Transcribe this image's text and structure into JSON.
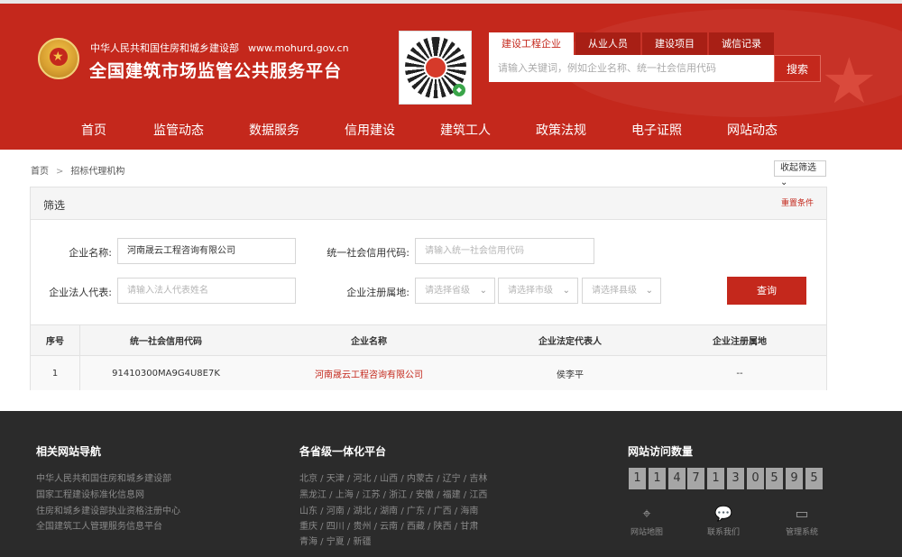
{
  "header": {
    "ministry": "中华人民共和国住房和城乡建设部",
    "domain": "www.mohurd.gov.cn",
    "title": "全国建筑市场监管公共服务平台",
    "search_tabs": [
      "建设工程企业",
      "从业人员",
      "建设项目",
      "诚信记录"
    ],
    "search_placeholder": "请输入关键词，例如企业名称、统一社会信用代码",
    "search_button": "搜索"
  },
  "nav": [
    "首页",
    "监管动态",
    "数据服务",
    "信用建设",
    "建筑工人",
    "政策法规",
    "电子证照",
    "网站动态"
  ],
  "breadcrumb": {
    "home": "首页",
    "current": "招标代理机构"
  },
  "collapse_label": "收起筛选 ⌄",
  "filter": {
    "title": "筛选",
    "reset": "重置条件",
    "company_name_label": "企业名称:",
    "company_name_value": "河南晟云工程咨询有限公司",
    "credit_code_label": "统一社会信用代码:",
    "credit_code_placeholder": "请输入统一社会信用代码",
    "legal_rep_label": "企业法人代表:",
    "legal_rep_placeholder": "请输入法人代表姓名",
    "region_label": "企业注册属地:",
    "province_placeholder": "请选择省级",
    "city_placeholder": "请选择市级",
    "county_placeholder": "请选择县级",
    "query_button": "查询"
  },
  "table": {
    "headers": [
      "序号",
      "统一社会信用代码",
      "企业名称",
      "企业法定代表人",
      "企业注册属地"
    ],
    "rows": [
      [
        "1",
        "91410300MA9G4U8E7K",
        "河南晟云工程咨询有限公司",
        "侯李平",
        "--"
      ]
    ]
  },
  "footer": {
    "links_title": "相关网站导航",
    "links": [
      "中华人民共和国住房和城乡建设部",
      "国家工程建设标准化信息网",
      "住房和城乡建设部执业资格注册中心",
      "全国建筑工人管理服务信息平台"
    ],
    "platform_title": "各省级一体化平台",
    "provinces": [
      "北京 / 天津 / 河北 / 山西 / 内蒙古 / 辽宁 / 吉林",
      "黑龙江 / 上海 / 江苏 / 浙江 / 安徽 / 福建 / 江西",
      "山东 / 河南 / 湖北 / 湖南 / 广东 / 广西 / 海南",
      "重庆 / 四川 / 贵州 / 云南 / 西藏 / 陕西 / 甘肃",
      "青海 / 宁夏 / 新疆"
    ],
    "visits_title": "网站访问数量",
    "visit_digits": [
      "1",
      "1",
      "4",
      "7",
      "1",
      "3",
      "0",
      "5",
      "9",
      "5"
    ],
    "icons": [
      {
        "label": "网站地图",
        "icon": "map-pin-icon"
      },
      {
        "label": "联系我们",
        "icon": "chat-icon"
      },
      {
        "label": "管理系统",
        "icon": "monitor-icon"
      }
    ]
  }
}
